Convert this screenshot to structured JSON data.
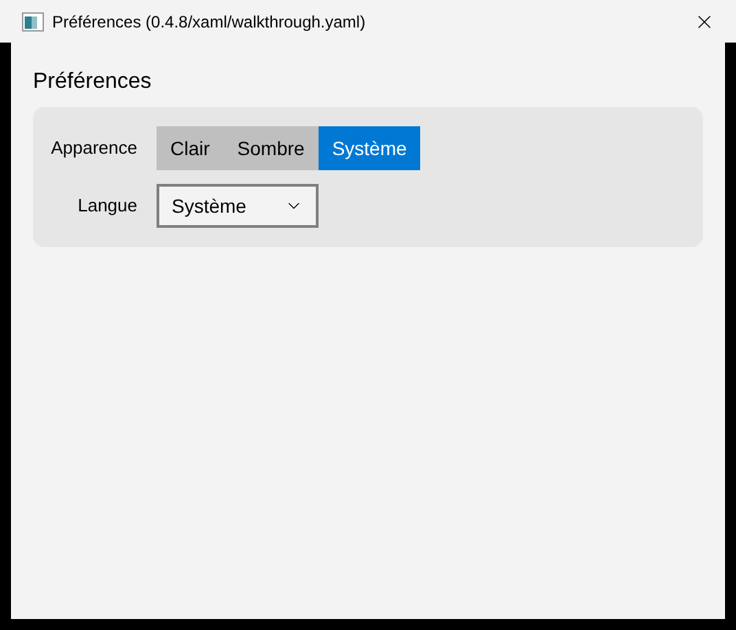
{
  "window": {
    "title": "Préférences (0.4.8/xaml/walkthrough.yaml)"
  },
  "heading": "Préférences",
  "appearance": {
    "label": "Apparence",
    "options": [
      {
        "label": "Clair",
        "selected": false
      },
      {
        "label": "Sombre",
        "selected": false
      },
      {
        "label": "Système",
        "selected": true
      }
    ]
  },
  "language": {
    "label": "Langue",
    "value": "Système"
  }
}
